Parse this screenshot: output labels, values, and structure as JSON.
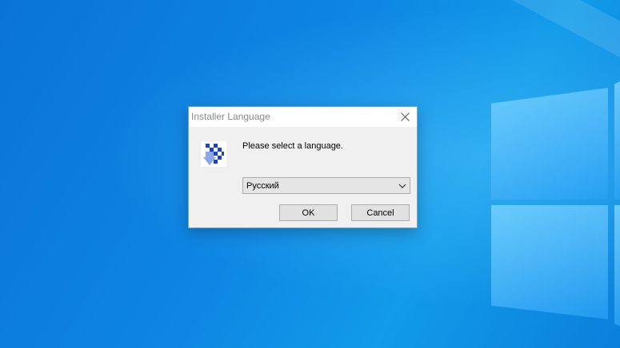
{
  "colors": {
    "desktop_blue": "#0e86e3",
    "dialog_bg": "#f0f0f0",
    "titlebar_bg": "#ffffff",
    "title_text": "#8a8a8a",
    "button_bg": "#e1e1e1",
    "icon_blue": "#1a3fd6"
  },
  "desktop": {
    "wallpaper": "windows-10-hero-blue",
    "logo_icon": "windows-logo-icon"
  },
  "dialog": {
    "title": "Installer Language",
    "close_icon": "close-icon",
    "app_icon": "installer-icon",
    "prompt": "Please select a language.",
    "language_select": {
      "selected": "Русский",
      "arrow_icon": "chevron-down-icon"
    },
    "buttons": {
      "ok_label": "OK",
      "cancel_label": "Cancel"
    }
  }
}
